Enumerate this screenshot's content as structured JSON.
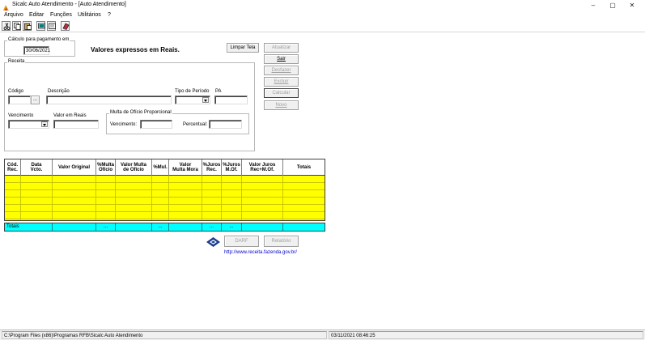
{
  "window": {
    "title": "Sicalc Auto Atendimento - [Auto Atendimento]",
    "controls": {
      "minimize": "–",
      "restore": "▢",
      "close": "✕"
    }
  },
  "menu": [
    "Arquivo",
    "Editar",
    "Funções",
    "Utilitários",
    "?"
  ],
  "toolbar": {
    "icons": [
      "scissors-icon",
      "copy-icon",
      "paste-icon",
      "screen-icon",
      "form-icon",
      "book-icon"
    ]
  },
  "form": {
    "payment_group_label": "Cálculo para pagamento em",
    "payment_date": "30/06/2021",
    "currency_note": "Valores expressos em Reais.",
    "receita_label": "Receita",
    "codigo_label": "Código",
    "codigo_btn": "...",
    "descricao_label": "Descrição",
    "tipo_periodo_label": "Tipo de Período",
    "pa_label": "PA",
    "vencimento_label": "Vencimento",
    "valor_reais_label": "Valor em Reais",
    "multa_group_label": "Multa de Ofício Proporcional",
    "multa_vencimento_label": "Vencimento:",
    "percentual_label": "Percentual:"
  },
  "buttons": {
    "limpar": "Limpar Tela",
    "atualizar": "Atualizar",
    "sair": "Sair",
    "desfazer": "Desfazer",
    "excluir": "Excluir",
    "calcular": "Calcular",
    "novo": "Novo",
    "dare": "DARF",
    "relatorio": "Relatório"
  },
  "grid": {
    "columns": [
      "Cód.\nRec.",
      "Data\nVcto.",
      "Valor Original",
      "%Multa\nOfício",
      "Valor Multa\nde Ofício",
      "%Mul.",
      "Valor\nMulta Mora",
      "%Juros\nRec.",
      "%Juros\nM.Of.",
      "Valor Juros\nRec+M.Of.",
      "Totais"
    ],
    "totals": {
      "label": "Totais",
      "c3": "...",
      "c5": "...",
      "c7": "...",
      "c8": "..."
    }
  },
  "link": "http://www.receita.fazenda.gov.br/",
  "status": {
    "path": "C:\\Program Files (x86)\\Programas RFB\\Sicalc Auto Atendimento",
    "datetime": "03/11/2021  08:46:25"
  },
  "colors": {
    "grid_fill": "#ffff00",
    "totals_fill": "#00ffff",
    "link": "#0000cc"
  }
}
